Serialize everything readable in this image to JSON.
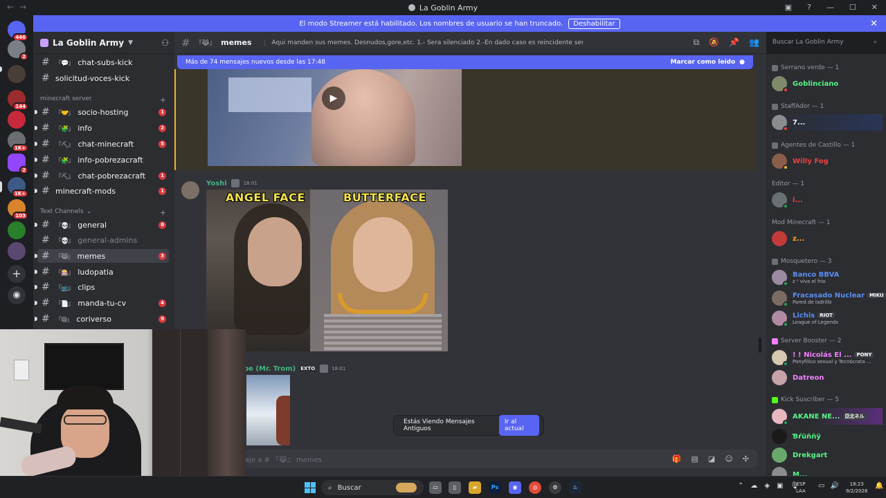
{
  "window": {
    "title": "La Goblin Army"
  },
  "banner": {
    "text": "El modo Streamer está habilitado. Los nombres de usuario se han truncado.",
    "button": "Deshabilitar"
  },
  "rail": {
    "badges": [
      "446",
      "2",
      "144",
      "1K+",
      "2",
      "1K+",
      "103"
    ]
  },
  "sidebar": {
    "server_name": "La Goblin Army",
    "top_channels": [
      {
        "emoji": "『💬』",
        "name": "chat-subs-kick"
      },
      {
        "emoji": "",
        "name": "solicitud-voces-kick"
      }
    ],
    "categories": {
      "minecraft": "minecraft server",
      "text": "Text Channels"
    },
    "minecraft_channels": [
      {
        "emoji": "『🤝』",
        "name": "socio-hosting",
        "unread": "1"
      },
      {
        "emoji": "『🧩』",
        "name": "info",
        "unread": "2"
      },
      {
        "emoji": "『⛏』",
        "name": "chat-minecraft",
        "unread": "5"
      },
      {
        "emoji": "『🧩』",
        "name": "info-pobrezacraft",
        "unread": ""
      },
      {
        "emoji": "『⛏』",
        "name": "chat-pobrezacraft",
        "unread": "1"
      },
      {
        "emoji": "",
        "name": "minecraft-mods",
        "unread": "1"
      }
    ],
    "text_channels": [
      {
        "emoji": "『💀』",
        "name": "general",
        "unread": "8"
      },
      {
        "emoji": "『💀』",
        "name": "general-admins",
        "unread": ""
      },
      {
        "emoji": "『😹』",
        "name": "memes",
        "unread": "3"
      },
      {
        "emoji": "『🎰』",
        "name": "ludopatia",
        "unread": ""
      },
      {
        "emoji": "『📺』",
        "name": "clips",
        "unread": ""
      },
      {
        "emoji": "『📄』",
        "name": "manda-tu-cv",
        "unread": "4"
      },
      {
        "emoji": "『😄』",
        "name": "coriverso",
        "unread": "9"
      }
    ]
  },
  "header": {
    "emoji": "『😹』",
    "channel": "memes",
    "topic": "Aqui manden sus memes. Desnudos,gore,etc. 1.- Sera silenciado 2.-En dado caso es reincidente sera baneado"
  },
  "search": {
    "placeholder": "Buscar La Goblin Army"
  },
  "chat": {
    "new_messages": "Más de 74 mensajes nuevos desde las 17:48",
    "mark_read": "Marcar como leído",
    "msg2": {
      "author": "Yoshi",
      "time": "18:01"
    },
    "meme_captions": {
      "left": "ANGEL FACE",
      "right": "BUTTERFACE"
    },
    "msg3": {
      "author": "pe (Mr. Trom)",
      "badge": "EXTO",
      "time": "18:01"
    },
    "old_messages": {
      "text": "Estás Viendo Mensajes Antiguos",
      "button": "Ir al actual"
    },
    "composer": {
      "placeholder": "aje a # 『😹』 memes"
    }
  },
  "members": [
    {
      "group": "Serrano verde — 1",
      "items": [
        {
          "name": "Goblinciano",
          "color": "#57f287"
        }
      ]
    },
    {
      "group": "StaffAdor — 1",
      "items": [
        {
          "name": "7...",
          "color": "#f2f3f5"
        }
      ]
    },
    {
      "group": "Agentes de Castillo — 1",
      "items": [
        {
          "name": "Willy Fog",
          "color": "#ed4245"
        }
      ]
    },
    {
      "group": "Editor — 1",
      "items": [
        {
          "name": "i...",
          "color": "#ed4245"
        }
      ]
    },
    {
      "group": "Mod Minecraft — 1",
      "items": [
        {
          "name": "z...",
          "color": "#faa61a"
        }
      ]
    },
    {
      "group": "Mosquetero — 3",
      "items": [
        {
          "name": "Banco BBVA",
          "color": "#5b8def",
          "activity": "z ᶻ viva el frio"
        },
        {
          "name": "Fracasado Nuclear",
          "color": "#5b8def",
          "tag": "MIKU",
          "activity": "Pared de ladrillo"
        },
        {
          "name": "Lichis",
          "color": "#5b8def",
          "tag": "RIOT",
          "activity": "League of Legends"
        }
      ]
    },
    {
      "group": "Server Booster — 2",
      "items": [
        {
          "name": "! ! Nicolás El ...",
          "color": "#f47fff",
          "tag": "PONY",
          "activity": "Ponyfílico sexual y Tecnócrata ..."
        },
        {
          "name": "Datreon",
          "color": "#f47fff"
        }
      ]
    },
    {
      "group": "Kick Suscriber — 5",
      "items": [
        {
          "name": "AKANE NE...",
          "color": "#57f287",
          "tag": "亞北ネル"
        },
        {
          "name": "Ɓŕüññÿ",
          "color": "#57f287"
        },
        {
          "name": "Drekgart",
          "color": "#57f287"
        },
        {
          "name": "M...",
          "color": "#57f287"
        }
      ]
    }
  ],
  "taskbar": {
    "search": "Buscar",
    "lang_top": "ESP",
    "lang_bottom": "LAA",
    "time": "18:23",
    "date": "9/2/2026"
  }
}
